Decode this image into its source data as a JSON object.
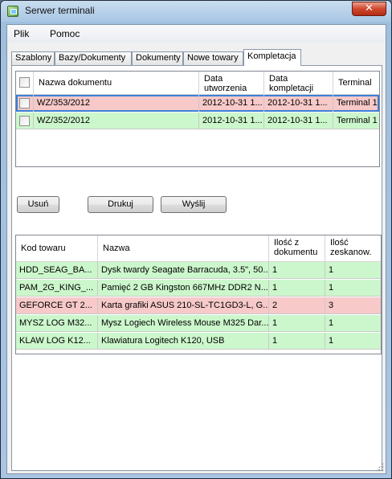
{
  "window": {
    "title": "Serwer terminali",
    "close_glyph": "✕"
  },
  "menu": {
    "items": [
      "Plik",
      "Pomoc"
    ]
  },
  "tabs": [
    "Szablony",
    "Bazy/Dokumenty",
    "Dokumenty",
    "Nowe towary",
    "Kompletacja"
  ],
  "active_tab": "Kompletacja",
  "documents": {
    "columns": [
      "Nazwa dokumentu",
      "Data\nutworzenia",
      "Data\nkompletacji",
      "Terminal"
    ],
    "rows": [
      {
        "name": "WZ/353/2012",
        "created": "2012-10-31 1...",
        "completed": "2012-10-31 1...",
        "terminal": "Terminal 1",
        "status": "red"
      },
      {
        "name": "WZ/352/2012",
        "created": "2012-10-31 1...",
        "completed": "2012-10-31 1...",
        "terminal": "Terminal 1",
        "status": "green"
      }
    ]
  },
  "buttons": {
    "delete": "Usuń",
    "print": "Drukuj",
    "send": "Wyślij"
  },
  "items": {
    "columns": [
      "Kod towaru",
      "Nazwa",
      "Ilość z\ndokumentu",
      "Ilość\nzeskanow."
    ],
    "rows": [
      {
        "code": "HDD_SEAG_BA...",
        "name": "Dysk twardy Seagate Barracuda, 3.5\", 50...",
        "doc_qty": "1",
        "scanned_qty": "1",
        "status": "green"
      },
      {
        "code": "PAM_2G_KING_...",
        "name": "Pamięć 2 GB Kingston 667MHz DDR2 N...",
        "doc_qty": "1",
        "scanned_qty": "1",
        "status": "green"
      },
      {
        "code": "GEFORCE GT 2...",
        "name": "Karta grafiki ASUS 210-SL-TC1GD3-L, G...",
        "doc_qty": "2",
        "scanned_qty": "3",
        "status": "red"
      },
      {
        "code": "MYSZ LOG M32...",
        "name": "Mysz Logiech Wireless Mouse M325 Dar...",
        "doc_qty": "1",
        "scanned_qty": "1",
        "status": "green"
      },
      {
        "code": "KLAW LOG K12...",
        "name": "Klawiatura Logitech K120, USB",
        "doc_qty": "1",
        "scanned_qty": "1",
        "status": "green"
      }
    ]
  },
  "colors": {
    "row_green": "#ccf7cc",
    "row_red": "#f7c9c9",
    "selection_border": "#3b7fd6"
  }
}
